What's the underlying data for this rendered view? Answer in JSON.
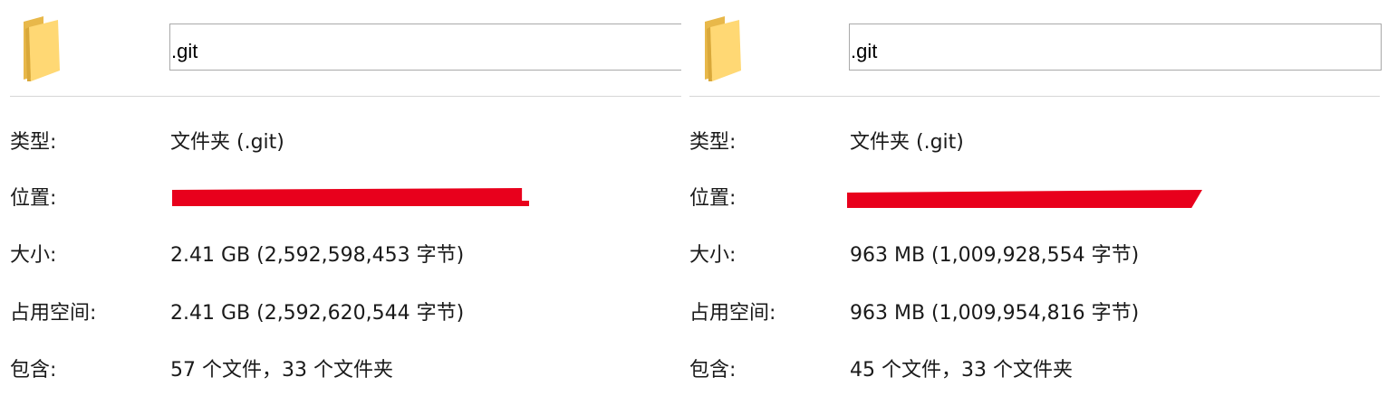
{
  "panels": [
    {
      "name_field": ".git",
      "properties": {
        "type_label": "类型:",
        "type_value": "文件夹 (.git)",
        "location_label": "位置:",
        "size_label": "大小:",
        "size_value": "2.41 GB (2,592,598,453 字节)",
        "disk_label": "占用空间:",
        "disk_value": "2.41 GB (2,592,620,544 字节)",
        "contains_label": "包含:",
        "contains_value": "57 个文件，33 个文件夹"
      }
    },
    {
      "name_field": ".git",
      "properties": {
        "type_label": "类型:",
        "type_value": "文件夹 (.git)",
        "location_label": "位置:",
        "size_label": "大小:",
        "size_value": "963 MB (1,009,928,554 字节)",
        "disk_label": "占用空间:",
        "disk_value": "963 MB (1,009,954,816 字节)",
        "contains_label": "包含:",
        "contains_value": "45 个文件，33 个文件夹"
      }
    }
  ],
  "icons": {
    "folder": "folder-icon",
    "folder_colors": {
      "back": "#E8B84A",
      "front": "#FFD874",
      "shade": "#D9A83A"
    }
  },
  "colors": {
    "redaction": "#E8001C",
    "divider": "#D6D6D6",
    "field_border": "#A9A9A9"
  }
}
